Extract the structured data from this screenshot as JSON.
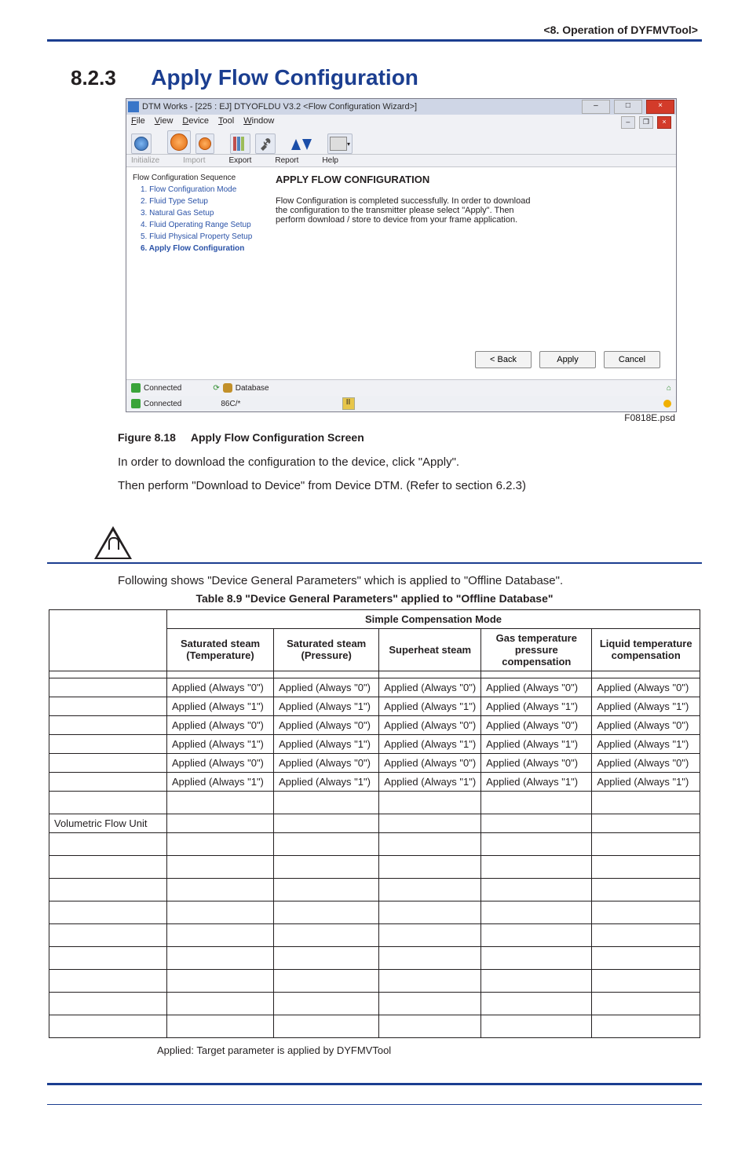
{
  "header": {
    "chapter": "<8.  Operation of DYFMVTool>"
  },
  "section": {
    "number": "8.2.3",
    "title": "Apply Flow Configuration"
  },
  "screenshot": {
    "psd": "F0818E.psd",
    "window_title": "DTM Works - [225 : EJ] DTYOFLDU V3.2 <Flow Configuration Wizard>]",
    "menu": {
      "file": "File",
      "view": "View",
      "device": "Device",
      "tool": "Tool",
      "window": "Window"
    },
    "subbar": {
      "initialize": "Initialize",
      "import": "Import",
      "export": "Export",
      "report": "Report",
      "help": "Help"
    },
    "side": {
      "header": "Flow Configuration Sequence",
      "s1": "1. Flow Configuration Mode",
      "s2": "2. Fluid Type Setup",
      "s3": "3. Natural Gas Setup",
      "s4": "4. Fluid Operating Range Setup",
      "s5": "5. Fluid Physical Property Setup",
      "s6": "6. Apply Flow Configuration"
    },
    "panel": {
      "title": "APPLY FLOW CONFIGURATION",
      "text": "Flow Configuration is completed successfully. In order to download the configuration to the transmitter please select \"Apply\". Then perform download / store to device from your frame application."
    },
    "buttons": {
      "back": "< Back",
      "apply": "Apply",
      "cancel": "Cancel"
    },
    "status1": {
      "connected": "Connected",
      "database": "Database"
    },
    "status2": {
      "connected": "Connected",
      "code": "86C/*"
    }
  },
  "fig": {
    "label": "Figure 8.18",
    "title": "Apply Flow Configuration Screen"
  },
  "p1": "In order to download the configuration to the device, click \"Apply\".",
  "p2": "Then perform \"Download to Device\" from Device DTM. (Refer to section 6.2.3)",
  "note_intro": "Following shows \"Device General Parameters\" which is applied to \"Offline Database\".",
  "tbl_caption": "Table 8.9   \"Device General Parameters\" applied to \"Offline Database\"",
  "table": {
    "super_head": "Simple Compensation Mode",
    "cols": {
      "c1": "Saturated steam (Temperature)",
      "c2": "Saturated steam (Pressure)",
      "c3": "Superheat steam",
      "c4": "Gas temperature pressure compensation",
      "c5": "Liquid temperature compensation"
    },
    "rowlabels": {
      "vfu": "Volumetric Flow Unit"
    },
    "rows": [
      {
        "c1": "",
        "c2": "",
        "c3": "",
        "c4": "",
        "c5": ""
      },
      {
        "c1": "Applied (Always \"0\")",
        "c2": "Applied (Always \"0\")",
        "c3": "Applied (Always \"0\")",
        "c4": "Applied (Always \"0\")",
        "c5": "Applied (Always \"0\")"
      },
      {
        "c1": "Applied (Always \"1\")",
        "c2": "Applied (Always \"1\")",
        "c3": "Applied (Always \"1\")",
        "c4": "Applied (Always \"1\")",
        "c5": "Applied (Always \"1\")"
      },
      {
        "c1": "Applied (Always \"0\")",
        "c2": "Applied (Always \"0\")",
        "c3": "Applied (Always \"0\")",
        "c4": "Applied (Always \"0\")",
        "c5": "Applied (Always \"0\")"
      },
      {
        "c1": "Applied (Always \"1\")",
        "c2": "Applied (Always \"1\")",
        "c3": "Applied (Always \"1\")",
        "c4": "Applied (Always \"1\")",
        "c5": "Applied (Always \"1\")"
      },
      {
        "c1": "Applied (Always \"0\")",
        "c2": "Applied (Always \"0\")",
        "c3": "Applied (Always \"0\")",
        "c4": "Applied (Always \"0\")",
        "c5": "Applied (Always \"0\")"
      },
      {
        "c1": "Applied (Always \"1\")",
        "c2": "Applied (Always \"1\")",
        "c3": "Applied (Always \"1\")",
        "c4": "Applied (Always \"1\")",
        "c5": "Applied (Always \"1\")"
      }
    ]
  },
  "tbl_footnote": "Applied: Target parameter is applied by DYFMVTool"
}
